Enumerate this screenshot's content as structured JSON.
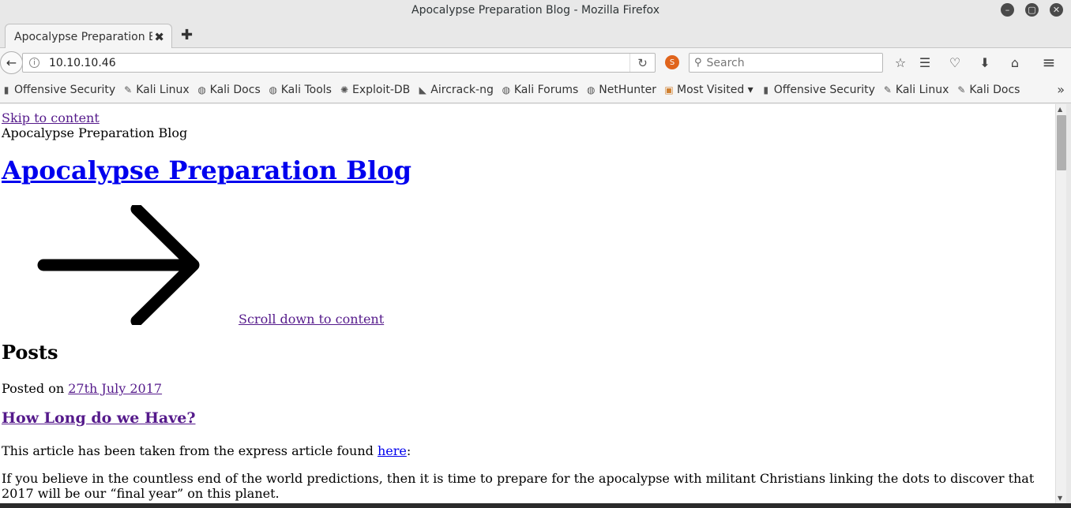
{
  "window": {
    "title": "Apocalypse Preparation Blog - Mozilla Firefox",
    "controls": {
      "minimize": "–",
      "maximize": "▢",
      "close": "✕"
    }
  },
  "tabs": [
    {
      "label": "Apocalypse Preparation B...",
      "close": "✖"
    }
  ],
  "new_tab": "✚",
  "navbar": {
    "back": "←",
    "url": "10.10.10.46",
    "info_icon": "i",
    "reload": "↻",
    "search_placeholder": "Search",
    "search_icon": "⚲",
    "icons": {
      "bookmark_star": "☆",
      "reading_list": "☰",
      "pocket": "♡",
      "downloads": "⬇",
      "home": "⌂",
      "menu": "≡"
    }
  },
  "bookmarks": [
    {
      "label": "Offensive Security",
      "icon": "offsec-icon"
    },
    {
      "label": "Kali Linux",
      "icon": "kali-dragon-icon"
    },
    {
      "label": "Kali Docs",
      "icon": "globe-icon"
    },
    {
      "label": "Kali Tools",
      "icon": "globe-icon"
    },
    {
      "label": "Exploit-DB",
      "icon": "exploitdb-icon"
    },
    {
      "label": "Aircrack-ng",
      "icon": "aircrack-icon"
    },
    {
      "label": "Kali Forums",
      "icon": "globe-icon"
    },
    {
      "label": "NetHunter",
      "icon": "globe-icon"
    },
    {
      "label": "Most Visited ▾",
      "icon": "folder-icon"
    },
    {
      "label": "Offensive Security",
      "icon": "offsec-icon"
    },
    {
      "label": "Kali Linux",
      "icon": "kali-dragon-icon"
    },
    {
      "label": "Kali Docs",
      "icon": "kali-dragon-icon"
    }
  ],
  "bookmarks_overflow": "»",
  "page": {
    "skip_link": "Skip to content",
    "site_name": "Apocalypse Preparation Blog",
    "site_title": "Apocalypse Preparation Blog",
    "scroll_link": "Scroll down to content",
    "posts_heading": "Posts",
    "posted_prefix": "Posted on ",
    "posted_date": "27th July 2017",
    "post_title": "How Long do we Have?",
    "para1_prefix": "This article has been taken from the express article found ",
    "para1_link": "here",
    "para1_suffix": ":",
    "para2": "If you believe in the countless end of the world predictions, then it is time to prepare for the apocalypse with militant Christians linking the dots to discover that 2017 will be our “final year” on this planet."
  },
  "scrollbar": {
    "up": "▲",
    "down": "▼",
    "position": 0.0
  }
}
